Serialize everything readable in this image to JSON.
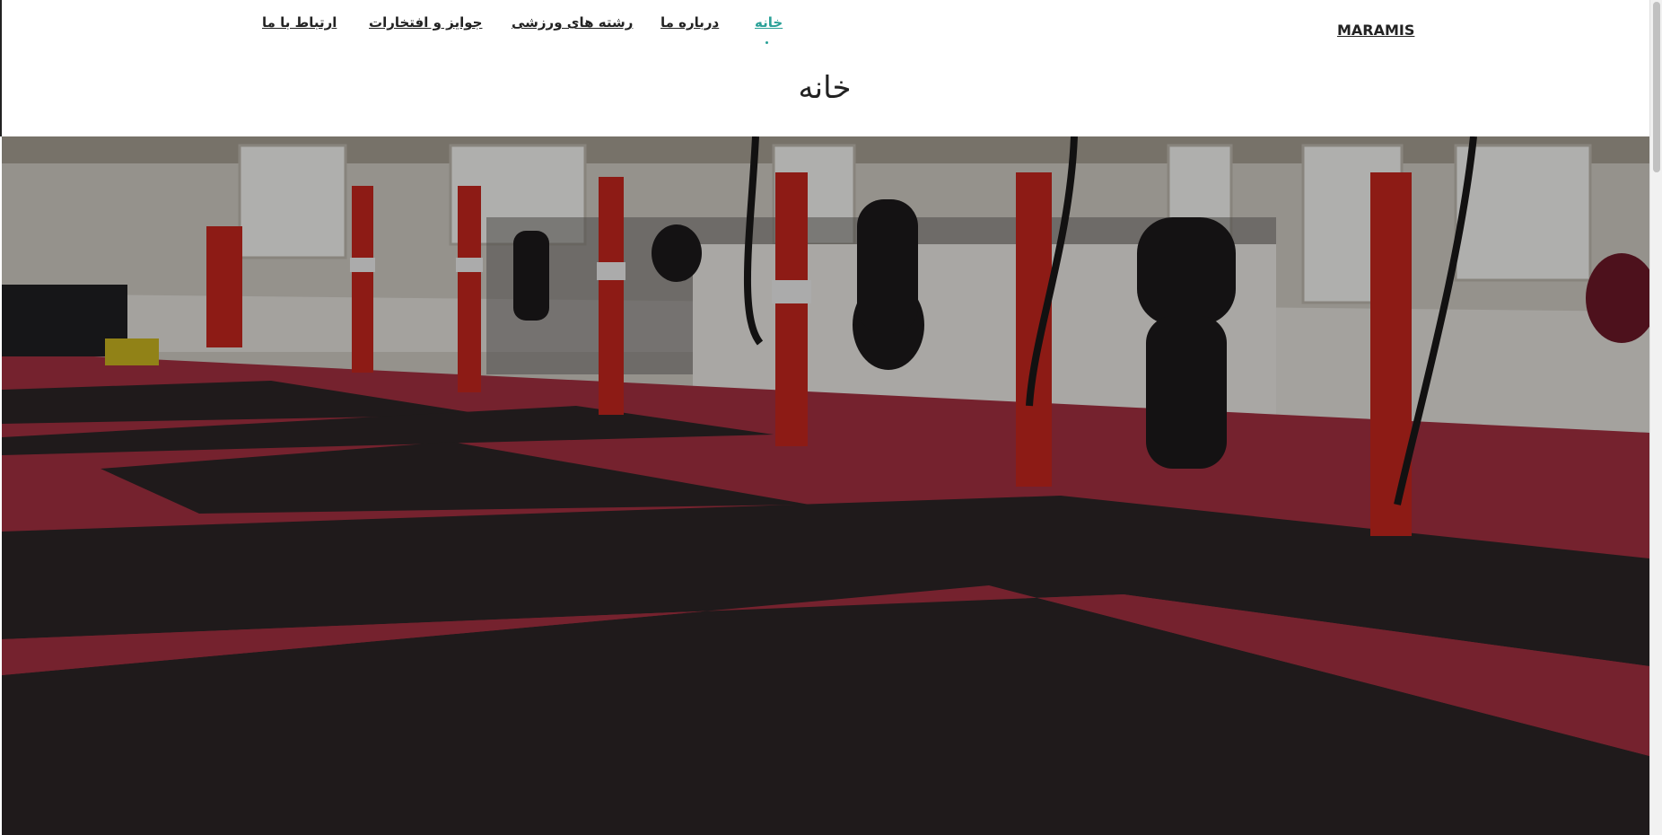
{
  "header": {
    "brand": "MARAMIS",
    "nav": [
      {
        "label": "خانه",
        "active": true
      },
      {
        "label": "درباره ما",
        "active": false
      },
      {
        "label": "رشته های ورزشی",
        "active": false
      },
      {
        "label": "جوایز و افتخارات",
        "active": false
      },
      {
        "label": "ارتباط با ما",
        "active": false
      }
    ]
  },
  "main": {
    "page_title": "خانه",
    "hero_image": "hero-image"
  },
  "colors": {
    "accent": "#2aa198",
    "text": "#222222",
    "mat_red": "#a23040",
    "mat_black": "#2b2526",
    "pillar_red": "#c4261e"
  }
}
